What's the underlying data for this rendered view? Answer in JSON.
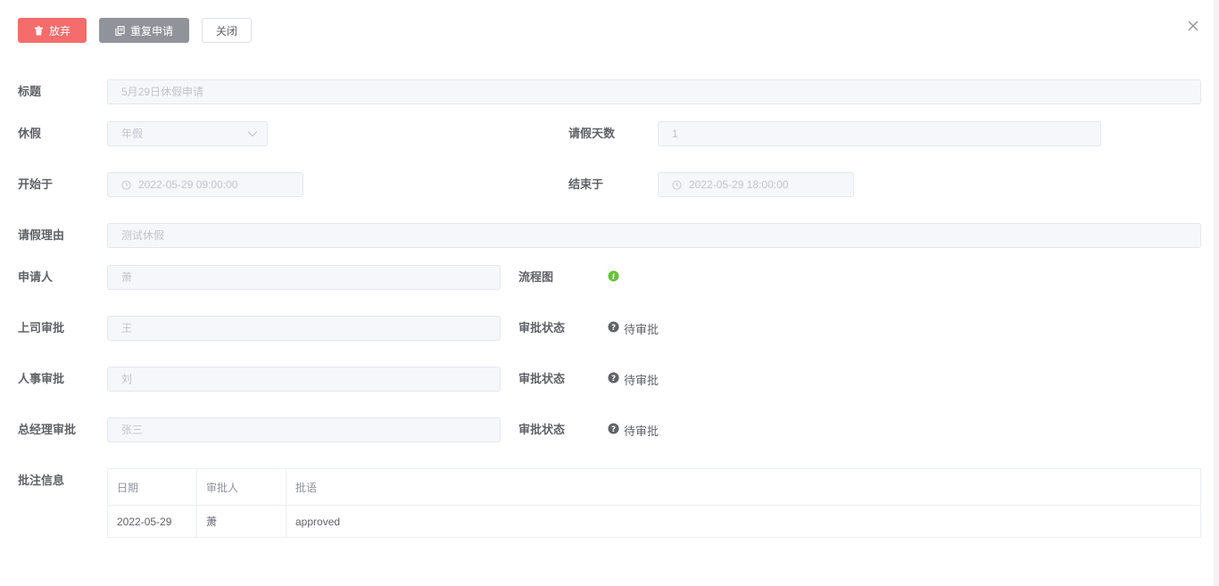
{
  "toolbar": {
    "abandon_label": "放弃",
    "reapply_label": "重复申请",
    "close_label": "关闭"
  },
  "form": {
    "title_label": "标题",
    "title_value": "5月29日休假申请",
    "leave_label": "休假",
    "leave_value": "年假",
    "days_label": "请假天数",
    "days_value": "1",
    "start_label": "开始于",
    "start_value": "2022-05-29 09:00:00",
    "end_label": "结束于",
    "end_value": "2022-05-29 18:00:00",
    "reason_label": "请假理由",
    "reason_value": "测试休假",
    "applicant_label": "申请人",
    "applicant_value": "萧",
    "flowchart_label": "流程图",
    "supervisor_label": "上司审批",
    "supervisor_value": "王",
    "hr_label": "人事审批",
    "hr_value": "刘",
    "gm_label": "总经理审批",
    "gm_value": "张三",
    "status_label": "审批状态",
    "status_pending": "待审批"
  },
  "comments": {
    "label": "批注信息",
    "headers": [
      "日期",
      "审批人",
      "批语"
    ],
    "rows": [
      [
        "2022-05-29",
        "萧",
        "approved"
      ]
    ]
  },
  "colors": {
    "danger": "#f56c6c",
    "info": "#909399",
    "success": "#67c23a"
  }
}
